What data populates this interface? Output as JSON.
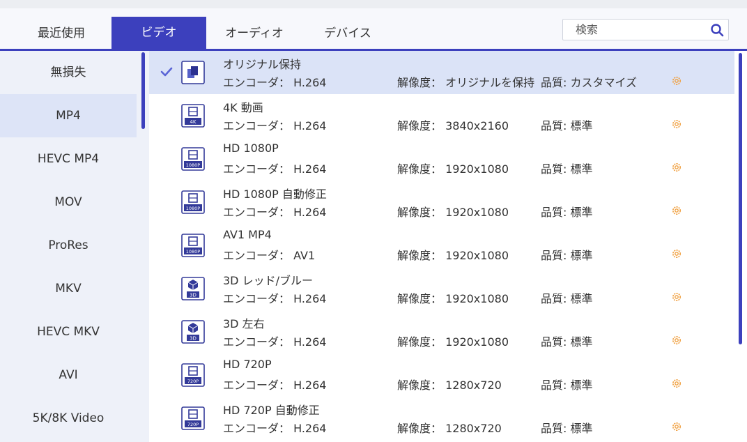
{
  "tabs": [
    {
      "label": "最近使用",
      "active": false
    },
    {
      "label": "ビデオ",
      "active": true
    },
    {
      "label": "オーディオ",
      "active": false
    },
    {
      "label": "デバイス",
      "active": false
    }
  ],
  "search": {
    "placeholder": "検索",
    "icon": "search-icon"
  },
  "sidebar": {
    "items": [
      {
        "label": "無損失",
        "active": false
      },
      {
        "label": "MP4",
        "active": true
      },
      {
        "label": "HEVC MP4",
        "active": false
      },
      {
        "label": "MOV",
        "active": false
      },
      {
        "label": "ProRes",
        "active": false
      },
      {
        "label": "MKV",
        "active": false
      },
      {
        "label": "HEVC MKV",
        "active": false
      },
      {
        "label": "AVI",
        "active": false
      },
      {
        "label": "5K/8K Video",
        "active": false
      }
    ]
  },
  "formats": [
    {
      "name": "オリジナル保持",
      "encoder": "エンコーダ：  H.264",
      "resolution": "解像度：  オリジナルを保持",
      "quality": "品質: カスタマイズ",
      "icon": "original-icon",
      "badge": "",
      "selected": true
    },
    {
      "name": "4K 動画",
      "encoder": "エンコーダ：  H.264",
      "resolution": "解像度：  3840x2160",
      "quality": "品質: 標準",
      "icon": "film-icon",
      "badge": "4K",
      "selected": false
    },
    {
      "name": "HD 1080P",
      "encoder": "エンコーダ：  H.264",
      "resolution": "解像度：  1920x1080",
      "quality": "品質: 標準",
      "icon": "film-icon",
      "badge": "1080P",
      "selected": false
    },
    {
      "name": "HD 1080P 自動修正",
      "encoder": "エンコーダ：  H.264",
      "resolution": "解像度：  1920x1080",
      "quality": "品質: 標準",
      "icon": "film-icon",
      "badge": "1080P",
      "selected": false
    },
    {
      "name": "AV1 MP4",
      "encoder": "エンコーダ：  AV1",
      "resolution": "解像度：  1920x1080",
      "quality": "品質: 標準",
      "icon": "film-icon",
      "badge": "1080P",
      "selected": false
    },
    {
      "name": "3D レッド/ブルー",
      "encoder": "エンコーダ：  H.264",
      "resolution": "解像度：  1920x1080",
      "quality": "品質: 標準",
      "icon": "cube-icon",
      "badge": "3D",
      "selected": false
    },
    {
      "name": "3D 左右",
      "encoder": "エンコーダ：  H.264",
      "resolution": "解像度：  1920x1080",
      "quality": "品質: 標準",
      "icon": "cube-icon",
      "badge": "3D",
      "selected": false
    },
    {
      "name": "HD 720P",
      "encoder": "エンコーダ：  H.264",
      "resolution": "解像度：  1280x720",
      "quality": "品質: 標準",
      "icon": "film-icon",
      "badge": "720P",
      "selected": false
    },
    {
      "name": "HD 720P 自動修正",
      "encoder": "エンコーダ：  H.264",
      "resolution": "解像度：  1280x720",
      "quality": "品質: 標準",
      "icon": "film-icon",
      "badge": "720P",
      "selected": false
    }
  ],
  "colors": {
    "accent": "#3c40bd",
    "selected_row": "#dbe3f7",
    "gear": "#f0a040",
    "sidebar": "#eef1f9"
  }
}
